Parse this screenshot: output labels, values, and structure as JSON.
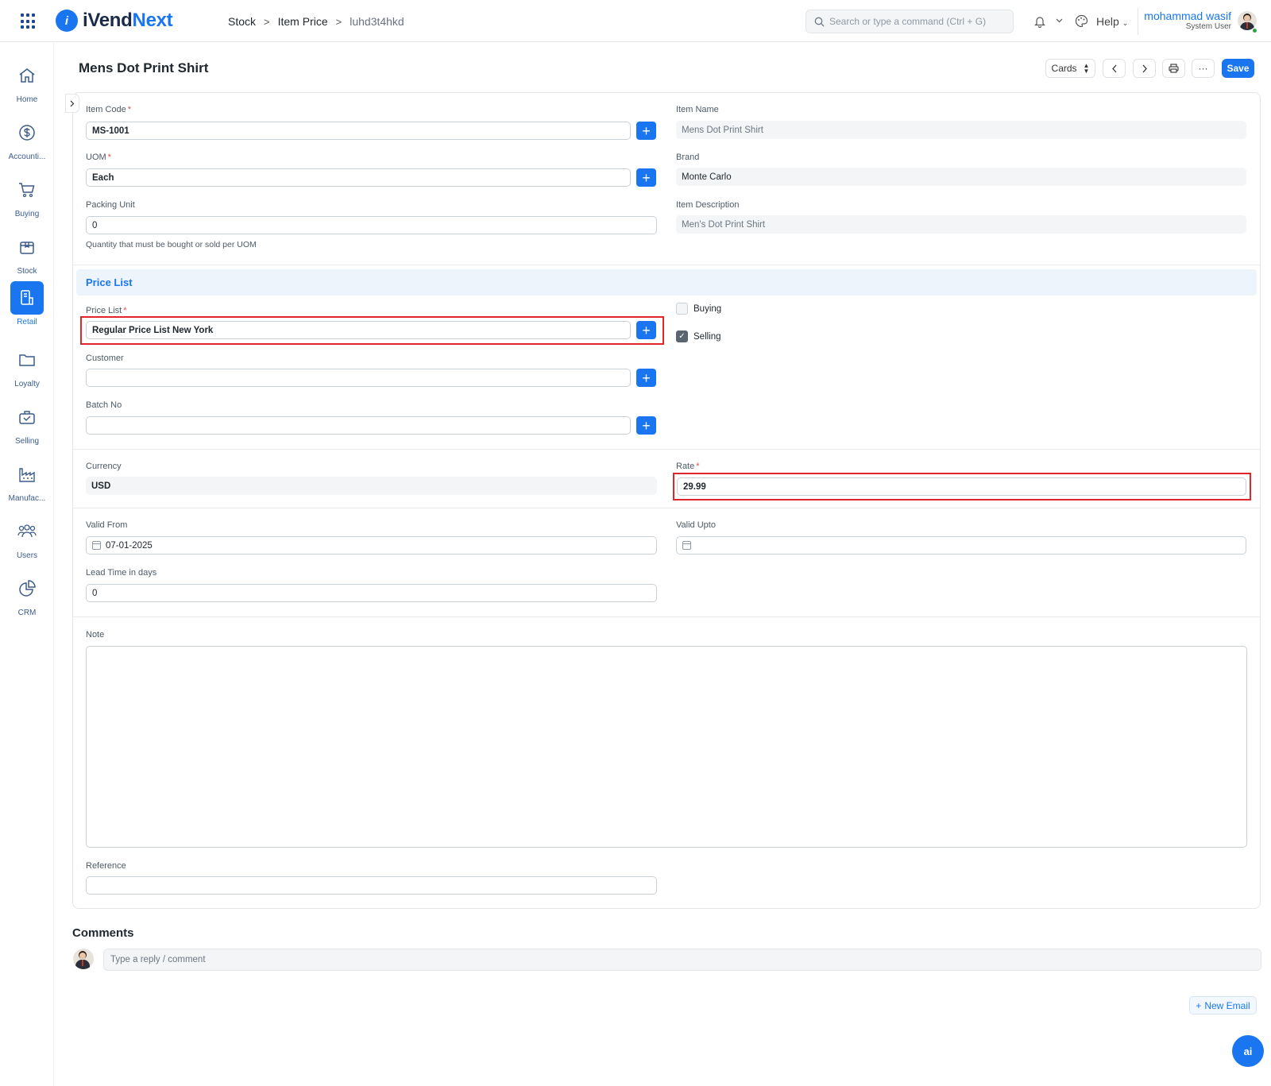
{
  "app": {
    "name_prefix": "iVend",
    "name_suffix": "Next",
    "logo_glyph": "i"
  },
  "breadcrumbs": [
    "Stock",
    "Item Price",
    "luhd3t4hkd"
  ],
  "breadcrumb_sep": ">",
  "search": {
    "placeholder": "Search or type a command (Ctrl + G)"
  },
  "topbar": {
    "help_label": "Help"
  },
  "user": {
    "name": "mohammad wasif",
    "role": "System User"
  },
  "sidebar": [
    {
      "label": "Home",
      "icon": "home-icon"
    },
    {
      "label": "Accounti...",
      "icon": "dollar-icon"
    },
    {
      "label": "Buying",
      "icon": "cart-icon"
    },
    {
      "label": "Stock",
      "icon": "box-icon"
    },
    {
      "label": "Retail",
      "icon": "retail-icon",
      "active": true
    },
    {
      "label": "Loyalty",
      "icon": "folder-icon"
    },
    {
      "label": "Selling",
      "icon": "selling-icon"
    },
    {
      "label": "Manufac...",
      "icon": "factory-icon"
    },
    {
      "label": "Users",
      "icon": "users-icon"
    },
    {
      "label": "CRM",
      "icon": "pie-icon"
    }
  ],
  "page": {
    "title": "Mens Dot Print Shirt"
  },
  "toolbar": {
    "view_label": "Cards",
    "save_label": "Save",
    "more_label": "···"
  },
  "form": {
    "item_code": {
      "label": "Item Code",
      "value": "MS-1001"
    },
    "uom": {
      "label": "UOM",
      "value": "Each"
    },
    "packing_unit": {
      "label": "Packing Unit",
      "value": "0",
      "help": "Quantity that must be bought or sold per UOM"
    },
    "item_name": {
      "label": "Item Name",
      "value": "Mens Dot Print Shirt"
    },
    "brand": {
      "label": "Brand",
      "value": "Monte Carlo"
    },
    "item_description": {
      "label": "Item Description",
      "value": "Men's Dot Print Shirt"
    },
    "section_price_list": "Price List",
    "price_list": {
      "label": "Price List",
      "value": "Regular Price List New York"
    },
    "customer": {
      "label": "Customer",
      "value": ""
    },
    "batch_no": {
      "label": "Batch No",
      "value": ""
    },
    "buying": {
      "label": "Buying",
      "checked": false
    },
    "selling": {
      "label": "Selling",
      "checked": true
    },
    "currency": {
      "label": "Currency",
      "value": "USD"
    },
    "rate": {
      "label": "Rate",
      "value": "29.99"
    },
    "valid_from": {
      "label": "Valid From",
      "value": "07-01-2025"
    },
    "valid_upto": {
      "label": "Valid Upto",
      "value": ""
    },
    "lead_time": {
      "label": "Lead Time in days",
      "value": "0"
    },
    "note": {
      "label": "Note",
      "value": ""
    },
    "reference": {
      "label": "Reference",
      "value": ""
    },
    "required_mark": "*"
  },
  "comments": {
    "title": "Comments",
    "placeholder": "Type a reply / comment"
  },
  "new_email_label": "New Email",
  "ai_label": "ai",
  "colors": {
    "accent": "#1976f0",
    "highlight": "#e0262b"
  }
}
